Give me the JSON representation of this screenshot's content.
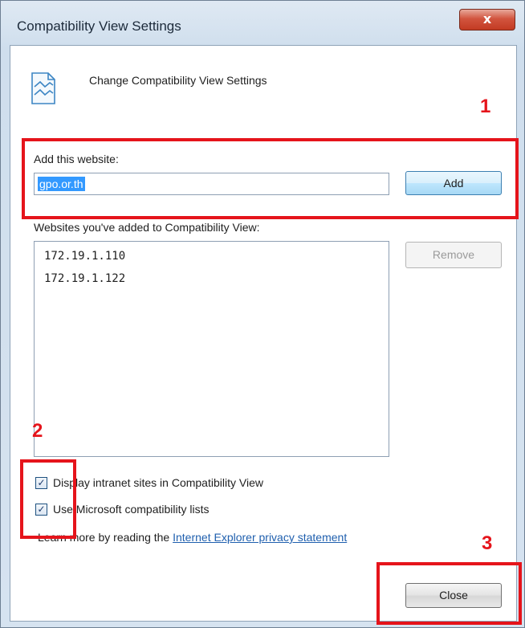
{
  "window": {
    "title": "Compatibility View Settings",
    "close_glyph": "x"
  },
  "header": {
    "icon": "compatibility-page-icon",
    "text": "Change Compatibility View Settings"
  },
  "add_section": {
    "label": "Add this website:",
    "input_value": "gpo.or.th",
    "add_button": "Add"
  },
  "list_section": {
    "label": "Websites you've added to Compatibility View:",
    "items": [
      "172.19.1.110",
      "172.19.1.122"
    ],
    "remove_button": "Remove"
  },
  "options": {
    "intranet": {
      "label": "Display intranet sites in Compatibility View",
      "checked": true
    },
    "ms_lists": {
      "label": "Use Microsoft compatibility lists",
      "checked": true
    }
  },
  "learn_more": {
    "prefix": "Learn more by reading the ",
    "link": "Internet Explorer privacy statement"
  },
  "close_button": "Close",
  "annotations": {
    "one": "1",
    "two": "2",
    "three": "3",
    "color": "#e5141b"
  }
}
